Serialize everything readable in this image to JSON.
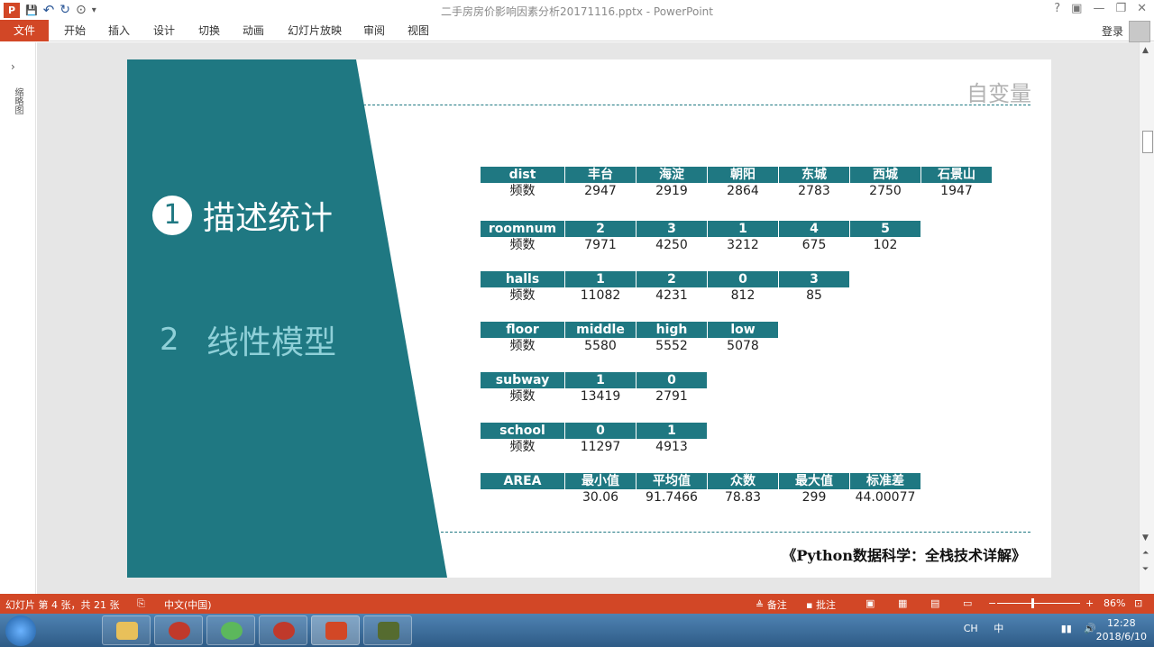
{
  "window": {
    "title": "二手房房价影响因素分析20171116.pptx - PowerPoint",
    "help": "?",
    "minimize": "—",
    "restore": "❐",
    "close": "✕"
  },
  "qat": {
    "logo": "P",
    "save": "💾",
    "undo": "↶",
    "redo": "↻",
    "present": "⊙",
    "more": "▾"
  },
  "ribbon": {
    "file": "文件",
    "tabs": [
      "开始",
      "插入",
      "设计",
      "切换",
      "动画",
      "幻灯片放映",
      "审阅",
      "视图"
    ],
    "login": "登录"
  },
  "leftpane": {
    "toggle": "›",
    "label": "缩略图"
  },
  "slide": {
    "heading": "自变量",
    "items": [
      {
        "num": "1",
        "label": "描述统计"
      },
      {
        "num": "2",
        "label": "线性模型"
      }
    ],
    "citation": "《Python数据科学：全栈技术详解》",
    "tables": [
      {
        "header": [
          "dist",
          "丰台",
          "海淀",
          "朝阳",
          "东城",
          "西城",
          "石景山"
        ],
        "row": [
          "频数",
          "2947",
          "2919",
          "2864",
          "2783",
          "2750",
          "1947"
        ]
      },
      {
        "header": [
          "roomnum",
          "2",
          "3",
          "1",
          "4",
          "5"
        ],
        "row": [
          "频数",
          "7971",
          "4250",
          "3212",
          "675",
          "102"
        ]
      },
      {
        "header": [
          "halls",
          "1",
          "2",
          "0",
          "3"
        ],
        "row": [
          "频数",
          "11082",
          "4231",
          "812",
          "85"
        ]
      },
      {
        "header": [
          "floor",
          "middle",
          "high",
          "low"
        ],
        "row": [
          "频数",
          "5580",
          "5552",
          "5078"
        ]
      },
      {
        "header": [
          "subway",
          "1",
          "0"
        ],
        "row": [
          "频数",
          "13419",
          "2791"
        ]
      },
      {
        "header": [
          "school",
          "0",
          "1"
        ],
        "row": [
          "频数",
          "11297",
          "4913"
        ]
      },
      {
        "header": [
          "AREA",
          "最小值",
          "平均值",
          "众数",
          "最大值",
          "标准差"
        ],
        "row": [
          "",
          "30.06",
          "91.7466",
          "78.83",
          "299",
          "44.00077"
        ]
      }
    ]
  },
  "statusbar": {
    "slide_info": "幻灯片 第 4 张，共 21 张",
    "language": "中文(中国)",
    "notes": "备注",
    "comments": "批注",
    "zoom_minus": "−",
    "zoom_plus": "+",
    "zoom": "86%",
    "zoom_level": 0.86
  },
  "taskbar": {
    "tray_text": "CH",
    "ime": "中",
    "time": "12:28",
    "date": "2018/6/10"
  },
  "colors": {
    "accent": "#d24726",
    "teal": "#1f7882",
    "teal_light": "#8fd0d8"
  }
}
